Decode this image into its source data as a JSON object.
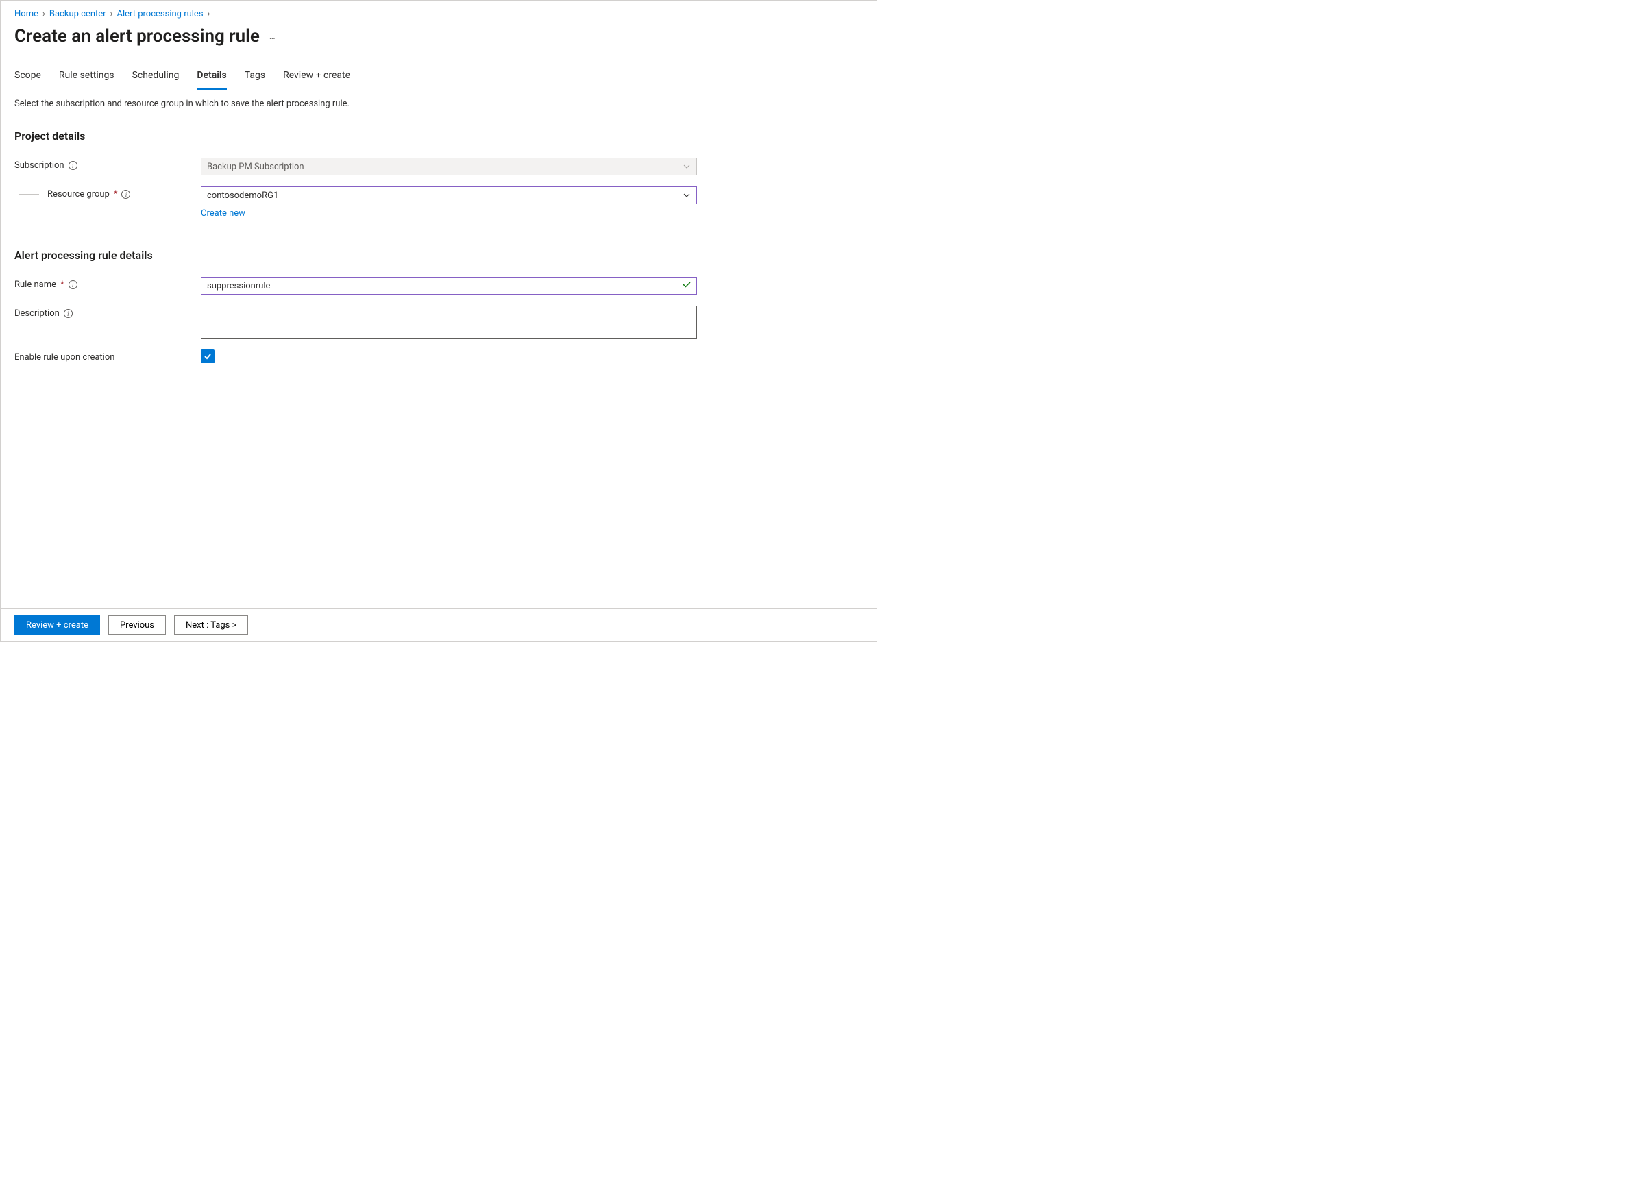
{
  "breadcrumb": {
    "items": [
      "Home",
      "Backup center",
      "Alert processing rules"
    ]
  },
  "page": {
    "title": "Create an alert processing rule"
  },
  "tabs": {
    "items": [
      "Scope",
      "Rule settings",
      "Scheduling",
      "Details",
      "Tags",
      "Review + create"
    ],
    "active": "Details"
  },
  "helper": "Select the subscription and resource group in which to save the alert processing rule.",
  "sections": {
    "project": {
      "heading": "Project details",
      "subscription_label": "Subscription",
      "subscription_value": "Backup PM Subscription",
      "resource_group_label": "Resource group",
      "resource_group_value": "contosodemoRG1",
      "create_new": "Create new"
    },
    "rule": {
      "heading": "Alert processing rule details",
      "rule_name_label": "Rule name",
      "rule_name_value": "suppressionrule",
      "description_label": "Description",
      "description_value": "",
      "enable_label": "Enable rule upon creation",
      "enable_checked": true
    }
  },
  "footer": {
    "review": "Review + create",
    "previous": "Previous",
    "next": "Next : Tags >"
  }
}
